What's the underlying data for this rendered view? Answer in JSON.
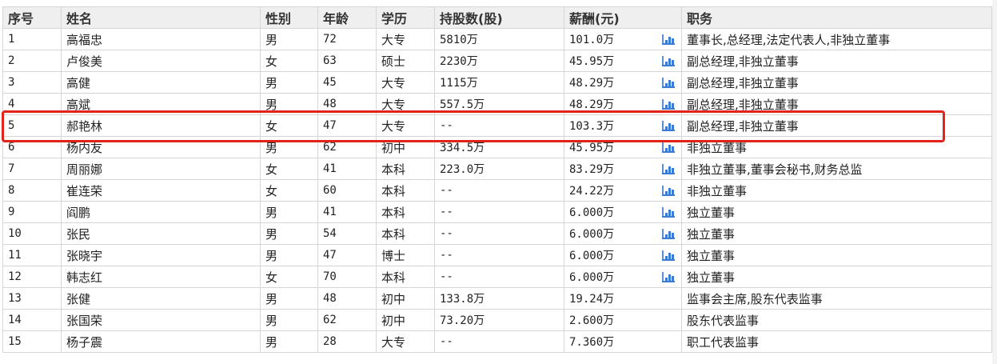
{
  "headers": [
    "序号",
    "姓名",
    "性别",
    "年龄",
    "学历",
    "持股数(股)",
    "薪酬(元)",
    "职务"
  ],
  "rows": [
    {
      "no": "1",
      "name": "高福忠",
      "gender": "男",
      "age": "72",
      "edu": "大专",
      "shares": "5810万",
      "salary": "101.0万",
      "chart": true,
      "title": "董事长,总经理,法定代表人,非独立董事"
    },
    {
      "no": "2",
      "name": "卢俊美",
      "gender": "女",
      "age": "63",
      "edu": "硕士",
      "shares": "2230万",
      "salary": "45.95万",
      "chart": true,
      "title": "副总经理,非独立董事"
    },
    {
      "no": "3",
      "name": "高健",
      "gender": "男",
      "age": "45",
      "edu": "大专",
      "shares": "1115万",
      "salary": "48.29万",
      "chart": true,
      "title": "副总经理,非独立董事"
    },
    {
      "no": "4",
      "name": "高斌",
      "gender": "男",
      "age": "48",
      "edu": "大专",
      "shares": "557.5万",
      "salary": "48.29万",
      "chart": true,
      "title": "副总经理,非独立董事"
    },
    {
      "no": "5",
      "name": "郝艳林",
      "gender": "女",
      "age": "47",
      "edu": "大专",
      "shares": "--",
      "salary": "103.3万",
      "chart": true,
      "title": "副总经理,非独立董事"
    },
    {
      "no": "6",
      "name": "杨内友",
      "gender": "男",
      "age": "62",
      "edu": "初中",
      "shares": "334.5万",
      "salary": "45.95万",
      "chart": true,
      "title": "非独立董事"
    },
    {
      "no": "7",
      "name": "周丽娜",
      "gender": "女",
      "age": "41",
      "edu": "本科",
      "shares": "223.0万",
      "salary": "83.29万",
      "chart": true,
      "title": "非独立董事,董事会秘书,财务总监"
    },
    {
      "no": "8",
      "name": "崔连荣",
      "gender": "女",
      "age": "60",
      "edu": "本科",
      "shares": "--",
      "salary": "24.22万",
      "chart": true,
      "title": "非独立董事"
    },
    {
      "no": "9",
      "name": "阎鹏",
      "gender": "男",
      "age": "41",
      "edu": "本科",
      "shares": "--",
      "salary": "6.000万",
      "chart": true,
      "title": "独立董事"
    },
    {
      "no": "10",
      "name": "张民",
      "gender": "男",
      "age": "54",
      "edu": "本科",
      "shares": "--",
      "salary": "6.000万",
      "chart": true,
      "title": "独立董事"
    },
    {
      "no": "11",
      "name": "张晓宇",
      "gender": "男",
      "age": "47",
      "edu": "博士",
      "shares": "--",
      "salary": "6.000万",
      "chart": true,
      "title": "独立董事"
    },
    {
      "no": "12",
      "name": "韩志红",
      "gender": "女",
      "age": "70",
      "edu": "本科",
      "shares": "--",
      "salary": "6.000万",
      "chart": true,
      "title": "独立董事"
    },
    {
      "no": "13",
      "name": "张健",
      "gender": "男",
      "age": "48",
      "edu": "初中",
      "shares": "133.8万",
      "salary": "19.24万",
      "chart": false,
      "title": "监事会主席,股东代表监事"
    },
    {
      "no": "14",
      "name": "张国荣",
      "gender": "男",
      "age": "62",
      "edu": "初中",
      "shares": "73.20万",
      "salary": "2.600万",
      "chart": false,
      "title": "股东代表监事"
    },
    {
      "no": "15",
      "name": "杨子震",
      "gender": "男",
      "age": "28",
      "edu": "大专",
      "shares": "--",
      "salary": "7.360万",
      "chart": false,
      "title": "职工代表监事"
    }
  ],
  "highlight_row_no": "5",
  "colors": {
    "highlight": "#e2231a",
    "chart_icon": "#3a7bd5",
    "header_bg": "#efefef"
  }
}
